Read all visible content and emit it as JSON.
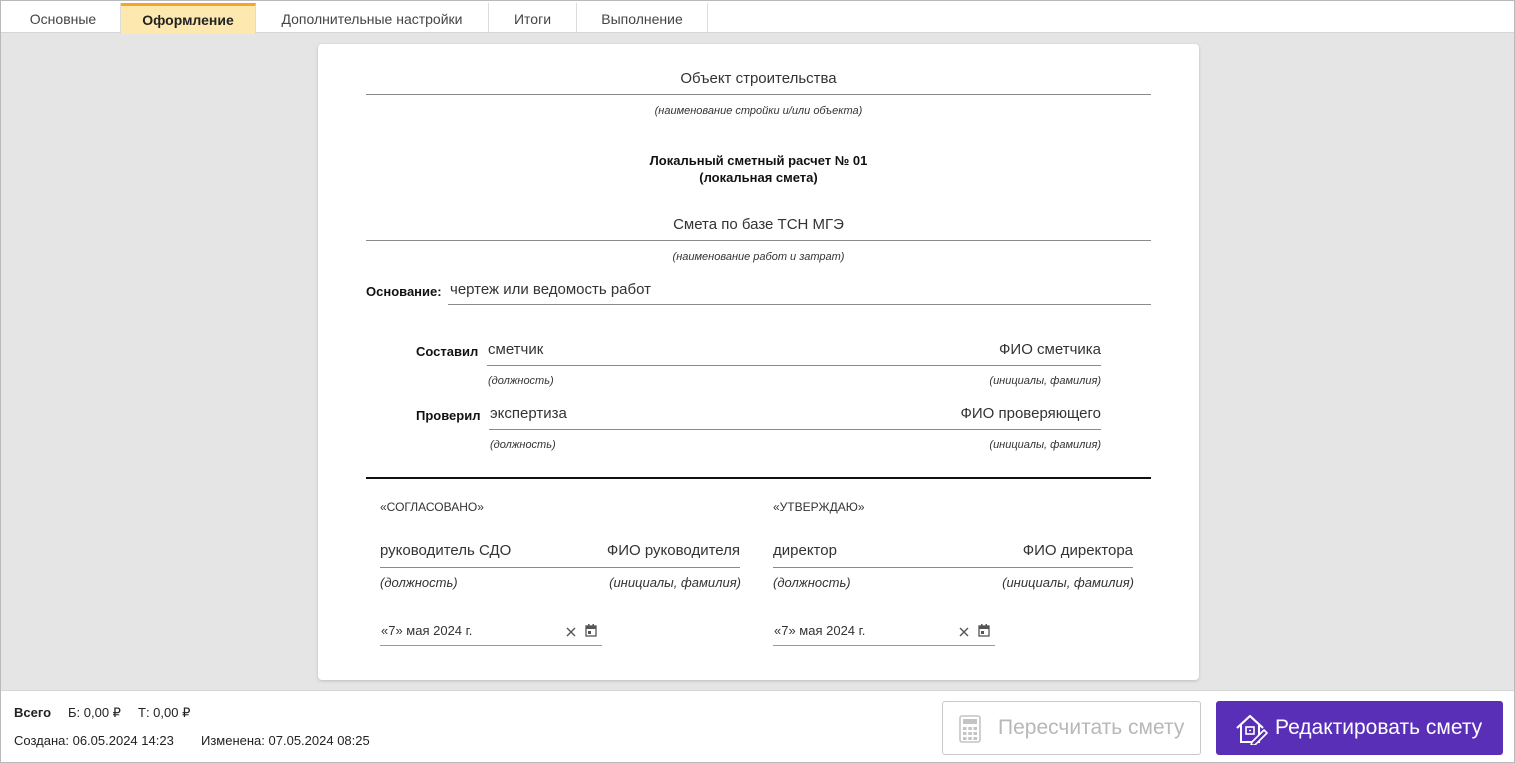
{
  "tabs": [
    {
      "label": "Основные"
    },
    {
      "label": "Оформление"
    },
    {
      "label": "Дополнительные настройки"
    },
    {
      "label": "Итоги"
    },
    {
      "label": "Выполнение"
    }
  ],
  "document": {
    "object_value": "Объект строительства",
    "object_caption": "(наименование стройки и/или объекта)",
    "title_line1": "Локальный сметный расчет № 01",
    "title_line2": "(локальная смета)",
    "works_value": "Смета по базе ТСН МГЭ",
    "works_caption": "(наименование работ и затрат)",
    "basis_label": "Основание:",
    "basis_value": "чертеж или ведомость работ",
    "compiled": {
      "label": "Составил",
      "position": "сметчик",
      "name": "ФИО сметчика",
      "position_caption": "(должность)",
      "name_caption": "(инициалы, фамилия)"
    },
    "checked": {
      "label": "Проверил",
      "position": "экспертиза",
      "name": "ФИО проверяющего",
      "position_caption": "(должность)",
      "name_caption": "(инициалы, фамилия)"
    },
    "agreed": {
      "heading": "«СОГЛАСОВАНО»",
      "position": "руководитель СДО",
      "name": "ФИО руководителя",
      "position_caption": "(должность)",
      "name_caption": "(инициалы, фамилия)",
      "date": "«7» мая 2024 г."
    },
    "approved": {
      "heading": "«УТВЕРЖДАЮ»",
      "position": "директор",
      "name": "ФИО директора",
      "position_caption": "(должность)",
      "name_caption": "(инициалы, фамилия)",
      "date": "«7» мая 2024 г."
    }
  },
  "footer": {
    "total_label": "Всего",
    "b_value": "Б: 0,00 ₽",
    "t_value": "Т: 0,00 ₽",
    "created": "Создана: 06.05.2024 14:23",
    "modified": "Изменена: 07.05.2024 08:25",
    "recalc_label": "Пересчитать смету",
    "edit_label": "Редактировать смету"
  },
  "colors": {
    "accent": "#5a2fb8",
    "active_tab_bg": "#fde8b0",
    "active_tab_bar": "#f5a623"
  }
}
